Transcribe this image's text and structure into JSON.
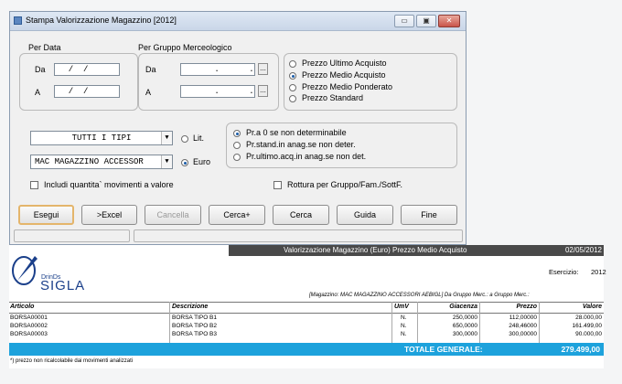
{
  "window": {
    "title": "Stampa Valorizzazione Magazzino [2012]",
    "btn_min": "▭",
    "btn_max": "▣",
    "btn_close": "✕"
  },
  "per_data": {
    "label": "Per Data",
    "da_label": "Da",
    "a_label": "A",
    "da_value": "  /  /",
    "a_value": "  /  /"
  },
  "per_gruppo": {
    "label": "Per Gruppo Merceologico",
    "da_label": "Da",
    "a_label": "A",
    "da_value": "      .      .",
    "a_value": "      .      .",
    "browse_label": "..."
  },
  "prezzo_options": [
    {
      "label": "Prezzo Ultimo Acquisto",
      "selected": false
    },
    {
      "label": "Prezzo Medio Acquisto",
      "selected": true
    },
    {
      "label": "Prezzo Medio Ponderato",
      "selected": false
    },
    {
      "label": "Prezzo Standard",
      "selected": false
    }
  ],
  "tipo_combo": {
    "value": "TUTTI I TIPI"
  },
  "magazzino_combo": {
    "value": "MAC MAGAZZINO ACCESSOR"
  },
  "valuta_options": [
    {
      "label": "Lit.",
      "selected": false
    },
    {
      "label": "Euro",
      "selected": true
    }
  ],
  "prezzo_zero_options": [
    {
      "label": "Pr.a 0 se non determinabile",
      "selected": true
    },
    {
      "label": "Pr.stand.in anag.se non deter.",
      "selected": false
    },
    {
      "label": "Pr.ultimo.acq.in anag.se non det.",
      "selected": false
    }
  ],
  "checkboxes": {
    "includi": "Includi quantita` movimenti a valore",
    "rottura": "Rottura per Gruppo/Fam./SottF."
  },
  "buttons": {
    "esegui": "Esegui",
    "excel": ">Excel",
    "cancella": "Cancella",
    "cerca_plus": "Cerca+",
    "cerca": "Cerca",
    "guida": "Guida",
    "fine": "Fine"
  },
  "report": {
    "title": "Valorizzazione Magazzino  (Euro) Prezzo Medio Acquisto",
    "date": "02/05/2012",
    "esercizio_label": "Esercizio:",
    "esercizio_value": "2012",
    "logo_top": "DrinDs",
    "logo_text": "SIGLA",
    "filter_text": "[Magazzino: MAC MAGAZZINO ACCESSORI AEBIGL]  Da Gruppo Merc.:       a Gruppo Merc.:",
    "columns": [
      "Articolo",
      "Descrizione",
      "UmV",
      "Giacenza",
      "Prezzo",
      "Valore"
    ],
    "rows": [
      [
        "BORSA00001",
        "BORSA TIPO B1",
        "N.",
        "250,0000",
        "112,00000",
        "28.000,00"
      ],
      [
        "BORSA00002",
        "BORSA TIPO B2",
        "N.",
        "650,0000",
        "248,46000",
        "161.499,00"
      ],
      [
        "BORSA00003",
        "BORSA TIPO B3",
        "N.",
        "300,0000",
        "300,00000",
        "90.000,00"
      ]
    ],
    "total_label": "TOTALE GENERALE:",
    "total_value": "279.499,00",
    "footnote": "*) prezzo non ricalcolabile dai movimenti analizzati"
  },
  "colors": {
    "total_bar": "#1da2dc",
    "report_header": "#494949",
    "default_button_border": "#e4b56b"
  }
}
